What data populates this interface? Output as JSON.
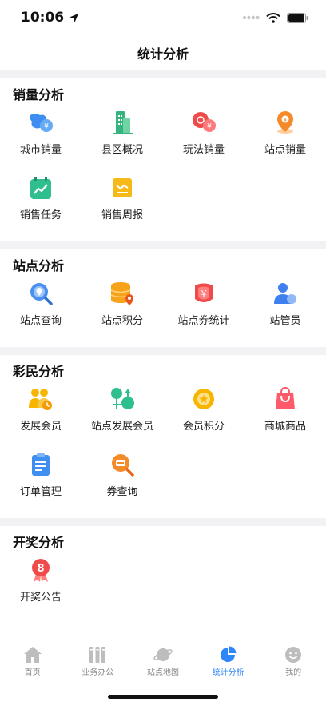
{
  "status_bar": {
    "time": "10:06"
  },
  "nav": {
    "title": "统计分析"
  },
  "sections": [
    {
      "title": "销量分析",
      "items": [
        {
          "label": "城市销量",
          "icon": "city-sales-icon"
        },
        {
          "label": "县区概况",
          "icon": "county-overview-icon"
        },
        {
          "label": "玩法销量",
          "icon": "game-sales-icon"
        },
        {
          "label": "站点销量",
          "icon": "station-sales-icon"
        },
        {
          "label": "销售任务",
          "icon": "sales-task-icon"
        },
        {
          "label": "销售周报",
          "icon": "sales-weekly-icon"
        }
      ]
    },
    {
      "title": "站点分析",
      "items": [
        {
          "label": "站点查询",
          "icon": "station-query-icon"
        },
        {
          "label": "站点积分",
          "icon": "station-points-icon"
        },
        {
          "label": "站点券统计",
          "icon": "station-coupon-icon"
        },
        {
          "label": "站管员",
          "icon": "station-manager-icon"
        }
      ]
    },
    {
      "title": "彩民分析",
      "items": [
        {
          "label": "发展会员",
          "icon": "develop-member-icon"
        },
        {
          "label": "站点发展会员",
          "icon": "station-member-icon"
        },
        {
          "label": "会员积分",
          "icon": "member-points-icon"
        },
        {
          "label": "商城商品",
          "icon": "mall-goods-icon"
        },
        {
          "label": "订单管理",
          "icon": "order-manage-icon"
        },
        {
          "label": "券查询",
          "icon": "coupon-query-icon"
        }
      ]
    },
    {
      "title": "开奖分析",
      "items": [
        {
          "label": "开奖公告",
          "icon": "lottery-notice-icon",
          "badge": "8"
        }
      ]
    }
  ],
  "tab_bar": {
    "tabs": [
      {
        "label": "首页",
        "icon": "home-icon",
        "active": false
      },
      {
        "label": "业务办公",
        "icon": "office-icon",
        "active": false
      },
      {
        "label": "站点地图",
        "icon": "planet-icon",
        "active": false
      },
      {
        "label": "统计分析",
        "icon": "pie-chart-icon",
        "active": true
      },
      {
        "label": "我的",
        "icon": "profile-icon",
        "active": false
      }
    ]
  },
  "colors": {
    "accent": "#2f86f6",
    "gap": "#f2f2f5",
    "tab_inactive": "#888888"
  }
}
